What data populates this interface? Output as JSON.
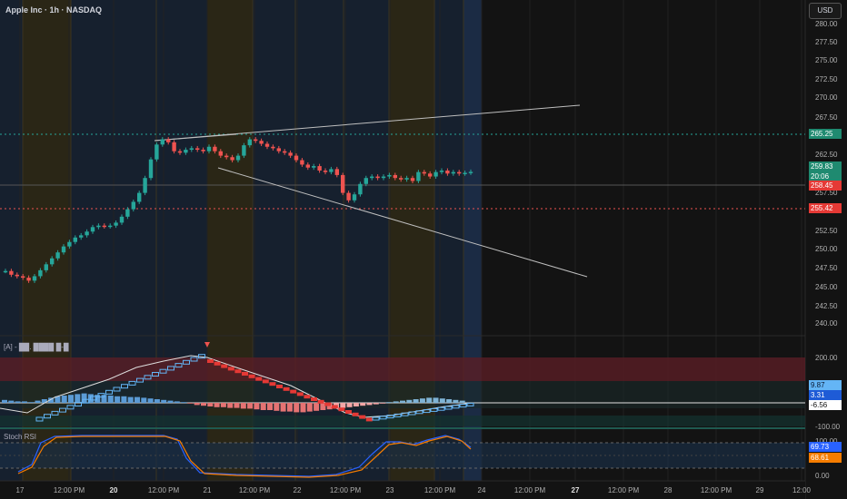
{
  "header": {
    "title": "Apple Inc · 1h · NASDAQ"
  },
  "currency_button": "USD",
  "price_axis": {
    "labels": [
      "280.00",
      "277.50",
      "275.00",
      "272.50",
      "270.00",
      "267.50",
      "262.50",
      "257.50",
      "252.50",
      "250.00",
      "247.50",
      "245.00",
      "242.50",
      "240.00"
    ]
  },
  "price_tags": [
    {
      "id": "resistance",
      "text": "265.25",
      "color": "#1f8a70"
    },
    {
      "id": "last",
      "text": "259.83",
      "color": "#1f8a70"
    },
    {
      "id": "countdown",
      "text": "20:06",
      "color": "#1f8a70"
    },
    {
      "id": "prev",
      "text": "258.45",
      "color": "#e53935"
    },
    {
      "id": "support",
      "text": "255.42",
      "color": "#e53935"
    }
  ],
  "time_axis": {
    "labels": [
      {
        "text": "17",
        "bold": false
      },
      {
        "text": "12:00 PM",
        "bold": false
      },
      {
        "text": "20",
        "bold": true
      },
      {
        "text": "12:00 PM",
        "bold": false
      },
      {
        "text": "21",
        "bold": false
      },
      {
        "text": "12:00 PM",
        "bold": false
      },
      {
        "text": "22",
        "bold": false
      },
      {
        "text": "12:00 PM",
        "bold": false
      },
      {
        "text": "23",
        "bold": false
      },
      {
        "text": "12:00 PM",
        "bold": false
      },
      {
        "text": "24",
        "bold": false
      },
      {
        "text": "12:00 PM",
        "bold": false
      },
      {
        "text": "27",
        "bold": true
      },
      {
        "text": "12:00 PM",
        "bold": false
      },
      {
        "text": "28",
        "bold": false
      },
      {
        "text": "12:00 PM",
        "bold": false
      },
      {
        "text": "29",
        "bold": false
      },
      {
        "text": "12:00",
        "bold": false
      }
    ]
  },
  "indicator1": {
    "label": "[A] - ██. ████ █-█",
    "axis_labels": [
      "200.00",
      "100.00",
      "-100.00"
    ],
    "tags": [
      {
        "text": "9.87",
        "color": "#64b5f6"
      },
      {
        "text": "3.31",
        "color": "#1e5bd6"
      },
      {
        "text": "-6.56",
        "color": "#ffffff",
        "dark": true
      }
    ]
  },
  "indicator2": {
    "label": "Stoch RSI",
    "axis_labels": [
      "100.00",
      "0.00"
    ],
    "tags": [
      {
        "text": "69.73",
        "color": "#2962ff"
      },
      {
        "text": "68.61",
        "color": "#f57c00"
      }
    ]
  },
  "colors": {
    "up": "#26a69a",
    "down": "#ef5350",
    "bg": "#131313"
  }
}
